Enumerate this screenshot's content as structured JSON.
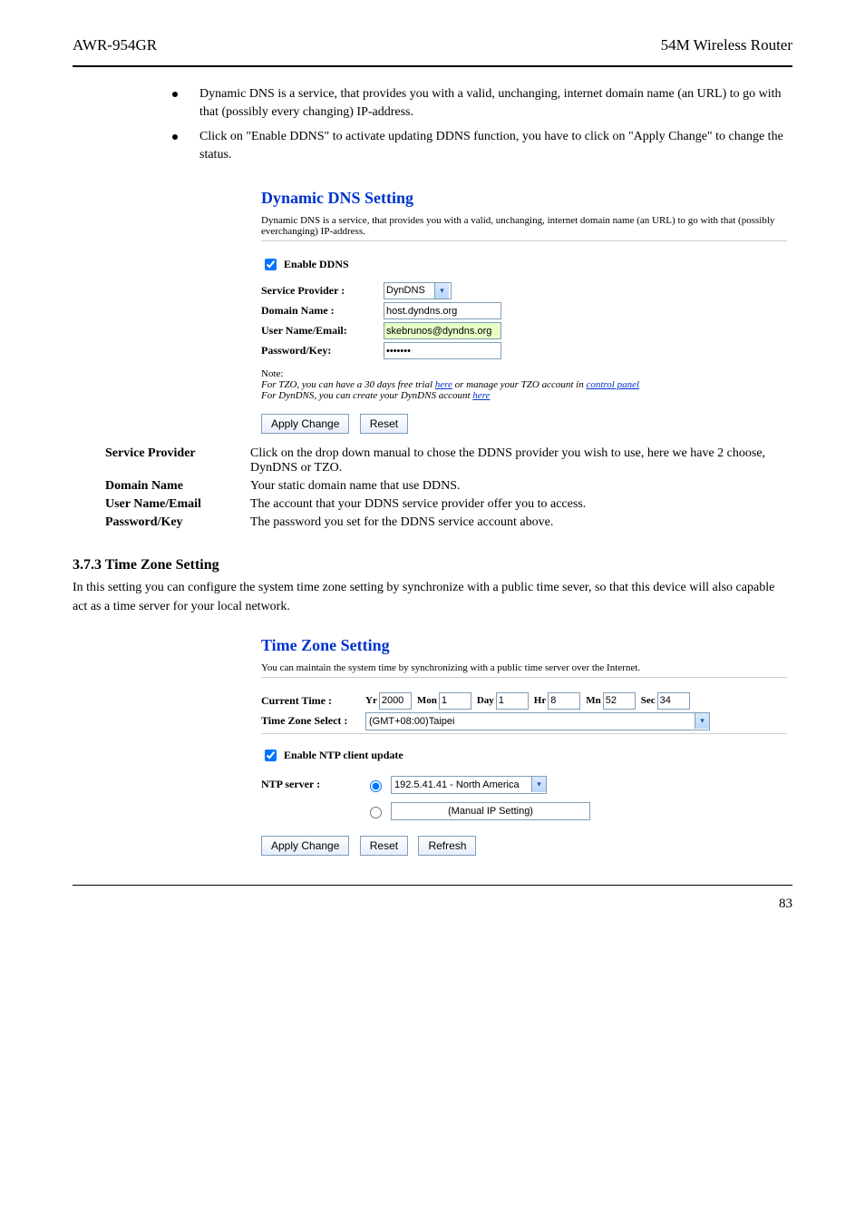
{
  "header": {
    "left": "AWR-954GR",
    "right": "54M Wireless Router"
  },
  "intro_bullets": [
    "Dynamic DNS is a service, that provides you with a valid, unchanging, internet domain name (an URL) to go with that (possibly every changing) IP-address.",
    "Click on \"Enable DDNS\" to activate updating DDNS function, you have to click on \"Apply Change\" to change the status."
  ],
  "ddns": {
    "title": "Dynamic DNS  Setting",
    "desc": "Dynamic DNS is a service, that provides you with a valid, unchanging, internet domain name (an URL) to go with that (possibly everchanging) IP-address.",
    "enable_label": "Enable DDNS",
    "provider_label": "Service Provider :",
    "provider_value": "DynDNS",
    "domain_label": "Domain Name :",
    "domain_value": "host.dyndns.org",
    "user_label": "User Name/Email:",
    "user_value": "skebrunos@dyndns.org",
    "pass_label": "Password/Key:",
    "pass_value": "•••••••",
    "note_label": "Note:",
    "note_line1a": "For TZO, you can have a 30 days free trial ",
    "note_here": "here",
    "note_line1b": " or manage your TZO account in ",
    "note_cp": "control panel",
    "note_line2a": "For DynDNS, you can create your DynDNS account ",
    "btn_apply": "Apply Change",
    "btn_reset": "Reset"
  },
  "ddns_fields": {
    "provider": {
      "label": "Service Provider",
      "text": "Click on the drop down manual to chose the DDNS provider you wish to use, here we have 2 choose, DynDNS or TZO."
    },
    "domain": {
      "label": "Domain Name",
      "text": "Your static domain name that use DDNS."
    },
    "user": {
      "label": "User Name/Email",
      "text": "The account that your DDNS service provider offer you to access."
    },
    "pass": {
      "label": "Password/Key",
      "text": "The password you set for the DDNS service account above."
    }
  },
  "tz_section": {
    "heading": "3.7.3 Time Zone Setting",
    "para": "In this setting you can configure the system time zone setting by synchronize with a public time sever, so that this device will also capable act as a time server for your local network."
  },
  "tz": {
    "title": "Time Zone Setting",
    "desc": "You can maintain the system time by synchronizing with a public time server over the Internet.",
    "current_time_label": "Current Time :",
    "yr_label": "Yr",
    "yr_val": "2000",
    "mon_label": "Mon",
    "mon_val": "1",
    "day_label": "Day",
    "day_val": "1",
    "hr_label": "Hr",
    "hr_val": "8",
    "mn_label": "Mn",
    "mn_val": "52",
    "sec_label": "Sec",
    "sec_val": "34",
    "zone_label": "Time Zone Select :",
    "zone_value": "(GMT+08:00)Taipei",
    "ntp_enable_label": "Enable NTP client update",
    "ntp_label": "NTP server :",
    "ntp_value": "192.5.41.41 - North America",
    "manual_label": "(Manual IP Setting)",
    "btn_apply": "Apply Change",
    "btn_reset": "Reset",
    "btn_refresh": "Refresh"
  },
  "footer": {
    "page": "83"
  }
}
